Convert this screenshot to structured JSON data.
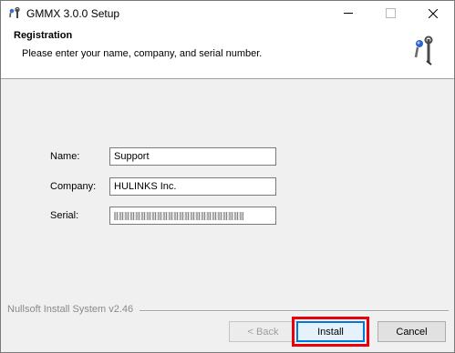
{
  "window": {
    "title": "GMMX 3.0.0 Setup"
  },
  "header": {
    "title": "Registration",
    "subtitle": "Please enter your name, company, and serial number."
  },
  "form": {
    "name_label": "Name:",
    "name_value": "Support",
    "company_label": "Company:",
    "company_value": "HULINKS Inc.",
    "serial_label": "Serial:"
  },
  "footer": {
    "branding": "Nullsoft Install System v2.46"
  },
  "buttons": {
    "back": "< Back",
    "install": "Install",
    "cancel": "Cancel"
  },
  "colors": {
    "highlight": "#e8000b",
    "focus": "#0078d7"
  },
  "icons": {
    "title": "installer-wrench-icon",
    "header": "installer-wrench-icon"
  }
}
